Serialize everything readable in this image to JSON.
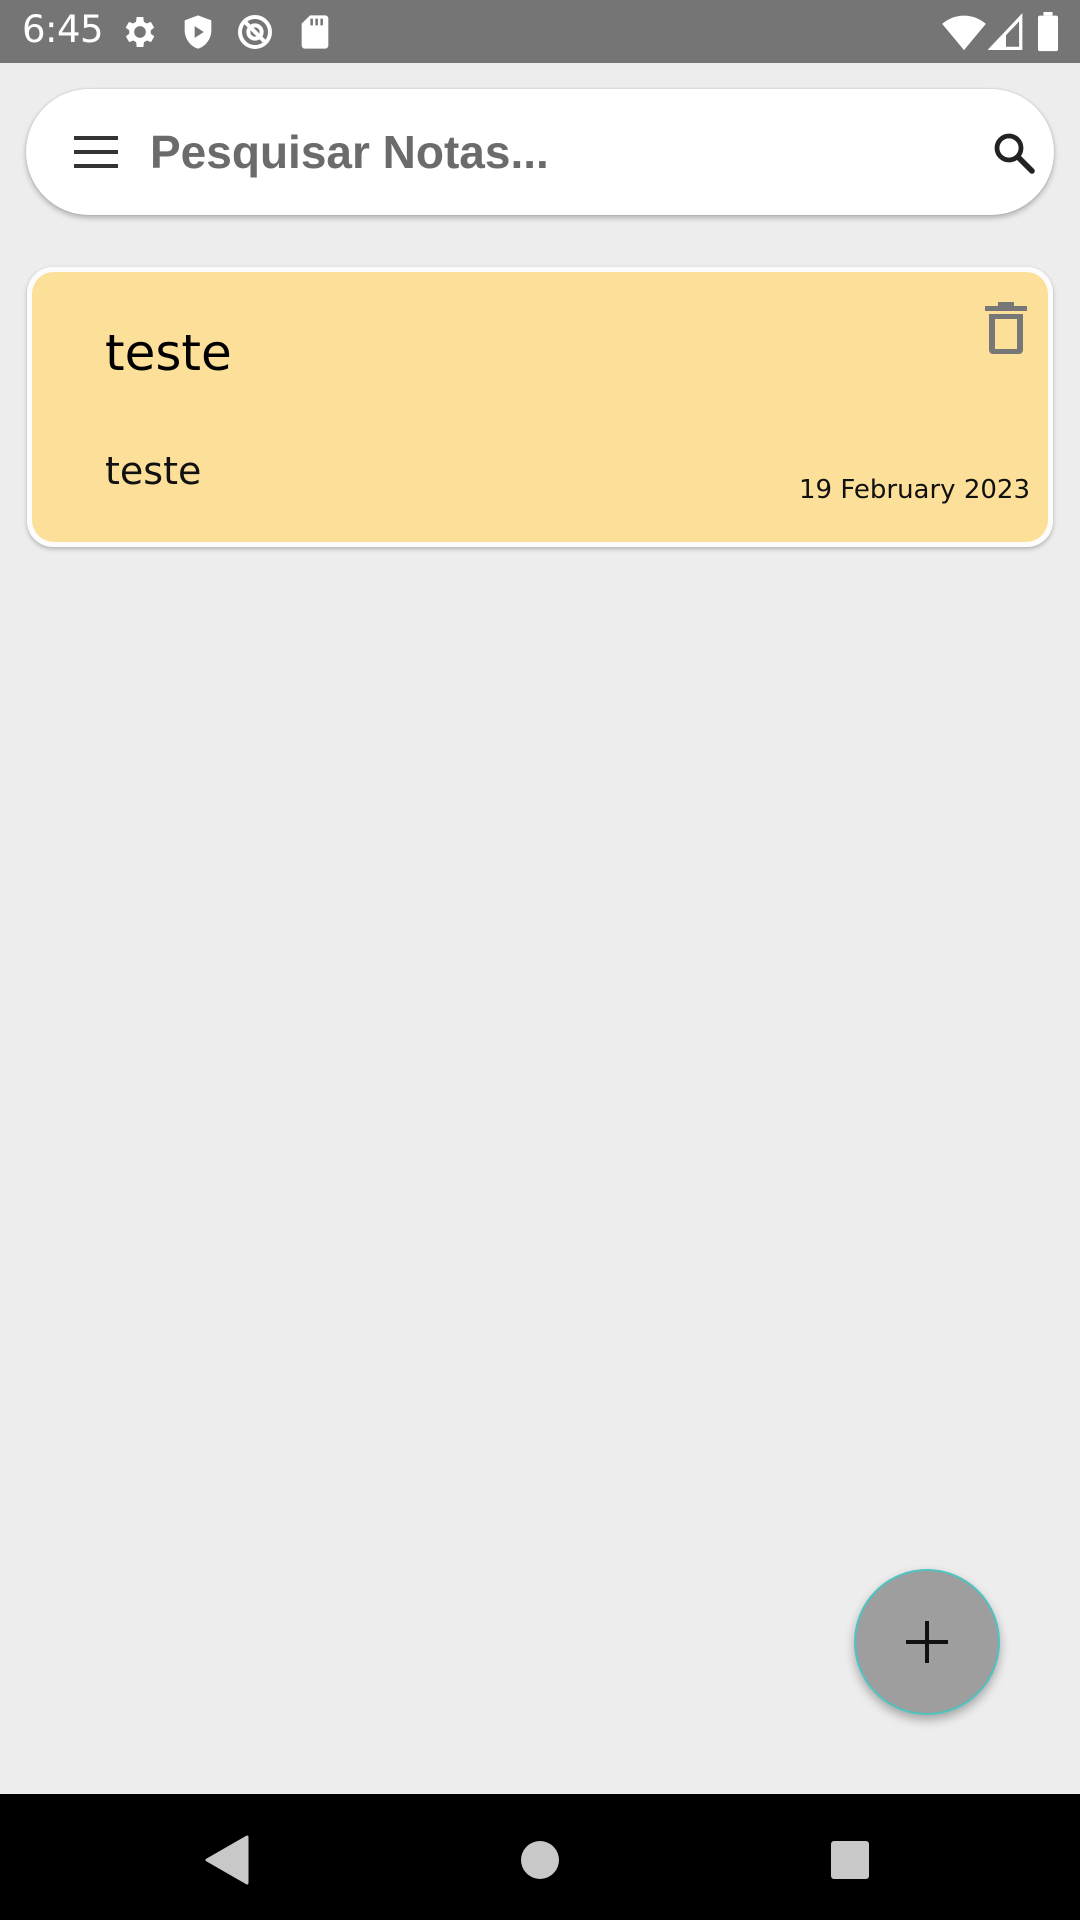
{
  "status_bar": {
    "time": "6:45",
    "left_icons": [
      "gear-icon",
      "shield-icon",
      "at-sign-icon",
      "sd-card-icon"
    ],
    "right_icons": [
      "wifi-icon",
      "cell-signal-icon",
      "battery-icon"
    ]
  },
  "search": {
    "placeholder": "Pesquisar Notas...",
    "value": "",
    "menu_icon": "menu-icon",
    "search_icon": "search-icon"
  },
  "notes": [
    {
      "title": "teste",
      "body": "teste",
      "date": "19 February 2023",
      "color": "#fcdf99",
      "delete_icon": "trash-icon"
    }
  ],
  "fab": {
    "icon": "plus-icon"
  },
  "nav_bar": {
    "buttons": [
      "back-icon",
      "home-icon",
      "recents-icon"
    ]
  },
  "colors": {
    "status_bar": "#757575",
    "background": "#ededed",
    "note_yellow": "#fcdf99",
    "fab": "#9e9e9e",
    "fab_border": "#4fc3c0",
    "nav_bar": "#000000"
  }
}
